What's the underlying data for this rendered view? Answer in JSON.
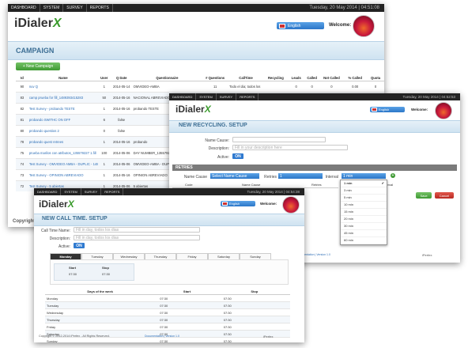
{
  "nav": [
    "Dashboard",
    "System",
    "Survey",
    "Reports"
  ],
  "date_main": "Tuesday, 20 May 2014 | 04:51:08",
  "date_recycling": "Tuesday, 20 May 2014 | 04:52:53",
  "date_calltime": "Tuesday, 20 May 2014 | 04:54:38",
  "logo": {
    "text": "iDialer",
    "x": "X"
  },
  "language": "English",
  "welcome": "Welcome:",
  "campaign": {
    "title": "CAMPAIGN",
    "new_button": "+ New Campaign",
    "columns": [
      "Id",
      "Name",
      "User",
      "Q Date",
      "Questionnaire",
      "# Questions",
      "CallTime",
      "Recycling",
      "Leads",
      "Called",
      "Not Called",
      "% Called",
      "Quota"
    ],
    "rows": [
      [
        "90",
        "nuv Q",
        "1",
        "2014-05-14",
        "OMVIDEO-AMBA",
        "11",
        "Todo el dia; todos los",
        "",
        "0",
        "0",
        "0",
        "0.00",
        "0"
      ],
      [
        "83",
        "camp prueba for fill_1489393415283",
        "50",
        "2014-05-16",
        "NACIONAL ABREVIADO",
        "",
        "",
        "",
        "",
        "",
        "",
        "",
        ""
      ],
      [
        "82",
        "Test Survey - probando TESTE",
        "1",
        "2014-05-16",
        "probando TESTE",
        "",
        "",
        "",
        "",
        "",
        "",
        "",
        ""
      ],
      [
        "81",
        "probando SWITHC ON OFF",
        "6",
        "false",
        "",
        "",
        "",
        "",
        "",
        "",
        "",
        "",
        ""
      ],
      [
        "80",
        "probando questios 2",
        "0",
        "false",
        "",
        "",
        "",
        "",
        "",
        "",
        "",
        "",
        ""
      ],
      [
        "78",
        "probando quest retrees",
        "1",
        "2014-05-16",
        "probando",
        "",
        "",
        "",
        "",
        "",
        "",
        "",
        ""
      ],
      [
        "75",
        "prueba marilos con atributos_135579227 1.fill",
        "100",
        "2014-05-06",
        "DAY NUMBER_135579227",
        "",
        "",
        "",
        "",
        "",
        "",
        "",
        ""
      ],
      [
        "74",
        "Test Survey - OMVIDEO AMBA - DUPLIC - 1485",
        "1",
        "2014-05-06",
        "OMVIDEO-AMBA - DUPLICADO",
        "",
        "",
        "",
        "",
        "",
        "",
        "",
        ""
      ],
      [
        "73",
        "Test Survey - OPINION ABREVIADO",
        "1",
        "2014-05-16",
        "OPINION ABREVIADO",
        "",
        "",
        "",
        "",
        "",
        "",
        "",
        ""
      ],
      [
        "72",
        "Test Survey - 5 abiertas",
        "1",
        "2014-05-06",
        "5 abiertas",
        "",
        "",
        "",
        "",
        "",
        "",
        "",
        ""
      ]
    ],
    "copyright_fragment": "Copyright"
  },
  "recycling": {
    "title": "NEW RECYCLING. SETUP",
    "fields": [
      {
        "label": "Name Cause:",
        "placeholder": ""
      },
      {
        "label": "Description:",
        "placeholder": "Fill in your description here"
      }
    ],
    "active_label": "Active:",
    "toggle": "ON",
    "section": "RETRIES",
    "cause_label": "Name Cause",
    "cause_value": "Select Name Cause",
    "retries_label": "Retries",
    "retries_value": "1",
    "interval_label": "Interval",
    "interval_value": "1 min",
    "intervals": [
      "1 min",
      "3 min",
      "5 min",
      "10 min",
      "15 min",
      "20 min",
      "30 min",
      "45 min",
      "60 min"
    ],
    "col_code": "Code",
    "col_name": "Name Cause",
    "col_retries": "Retries",
    "col_interval": "Interval",
    "save": "Save",
    "cancel": "Cancel",
    "footer": "Documentation | Version 1.0",
    "footer_brand": "iPerfex"
  },
  "calltime": {
    "title": "NEW CALL TIME. SETUP",
    "fields": [
      {
        "label": "Call Time Name:",
        "placeholder": "Fill in day, todos los dias"
      },
      {
        "label": "Description:",
        "placeholder": "Fill in day, todos los dias"
      }
    ],
    "active_label": "Active:",
    "toggle": "ON",
    "days": [
      "Monday",
      "Tuesday",
      "Wednesday",
      "Thursday",
      "Friday",
      "Saturday",
      "Sunday"
    ],
    "start_label": "Start",
    "stop_label": "Stop",
    "start_value": "07:30",
    "stop_value": "07:30",
    "table_cols": [
      "Days of the week",
      "Start",
      "Stop"
    ],
    "table_rows": [
      [
        "Monday",
        "07:30",
        "07:30"
      ],
      [
        "Tuesday",
        "07:30",
        "07:30"
      ],
      [
        "Wednesday",
        "07:30",
        "07:30"
      ],
      [
        "Thursday",
        "07:30",
        "07:30"
      ],
      [
        "Friday",
        "07:30",
        "07:30"
      ],
      [
        "Saturday",
        "07:30",
        "07:30"
      ],
      [
        "Sunday",
        "07:30",
        "07:30"
      ]
    ],
    "copyright": "Copyright © 2012-2014 iPerfex - All Rights Reserved.",
    "footer": "Documentation | Version 1.0",
    "footer_brand": "iPerfex"
  },
  "colors": {
    "accent": "#2b76c8",
    "green": "#3f9a33",
    "red": "#b92a22",
    "dark": "#222222"
  }
}
